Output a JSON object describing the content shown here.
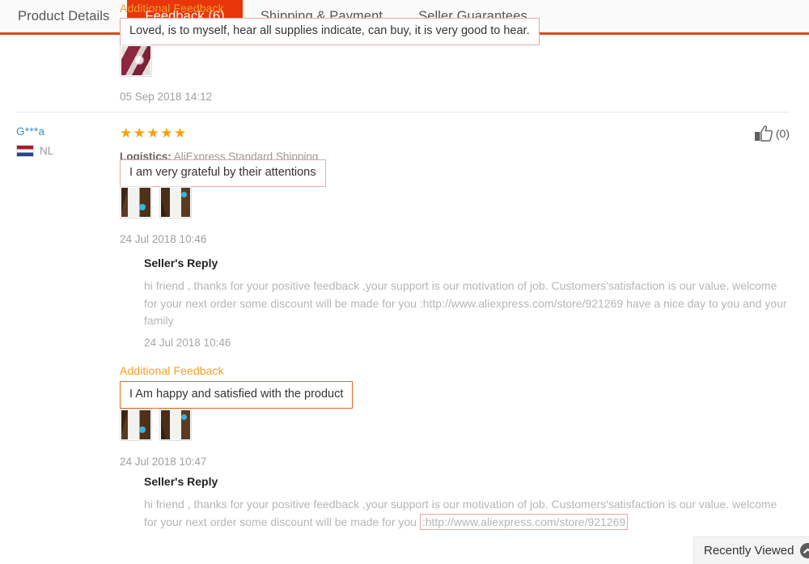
{
  "tabs": [
    {
      "label": "Product Details",
      "active": false
    },
    {
      "label": "Feedback (6)",
      "active": true
    },
    {
      "label": "Shipping & Payment",
      "active": false
    },
    {
      "label": "Seller Guarantees",
      "active": false
    }
  ],
  "colors": {
    "accent_red": "#e8360a",
    "tab_underline": "#d9481f",
    "star_orange": "#f7a200",
    "additional_feedback_orange": "#f0a02a",
    "username_blue": "#3a8ec9",
    "review_box_border": "#e8a6a6",
    "review_box_border_orange": "#dd6a2c"
  },
  "reviews": [
    {
      "additional_label": "Additional Feedback",
      "text": "Loved, is to myself, hear all supplies indicate, can buy, it is very good to hear.",
      "thumbnails": [
        "review-photo-maroon"
      ],
      "timestamp": "05 Sep 2018 14:12"
    },
    {
      "username": "G***a",
      "country_flag": "flag-netherlands",
      "country": "NL",
      "stars": 5,
      "stars_glyphs": "★★★★★",
      "logistics_label": "Logistics:",
      "logistics_value": "AliExpress Standard Shipping",
      "text": "I am very grateful by their attentions",
      "thumbnails": [
        "review-photo-wood-a",
        "review-photo-wood-b"
      ],
      "timestamp": "24 Jul 2018 10:46",
      "like_icon": "thumbs-up-icon",
      "like_count": "(0)",
      "reply": {
        "title": "Seller's Reply",
        "body_line1": "hi friend , thanks for your positive feedback ,your support is our motivation of job. Customers'satisfaction is our value.",
        "body_line2_before": "welcome for your next order some discount will be made for you :",
        "body_url": "http://www.aliexpress.com/store/921269",
        "body_line2_after": " have a nice day to",
        "body_line3": "you and your family",
        "timestamp": "24 Jul 2018 10:46"
      }
    },
    {
      "additional_label": "Additional Feedback",
      "text": "I Am happy and satisfied with the product",
      "thumbnails": [
        "review-photo-wood-a",
        "review-photo-wood-b"
      ],
      "timestamp": "24 Jul 2018 10:47",
      "reply": {
        "title": "Seller's Reply",
        "body_line1": "hi friend , thanks for your positive feedback ,your support is our motivation of job. Customers'satisfaction is our value.",
        "body_line2_before": "welcome for your next order some discount will be made for you ",
        "body_url": ":http://www.aliexpress.com/store/921269"
      }
    }
  ],
  "recently_viewed": {
    "label": "Recently Viewed",
    "icon": "chevron-up-icon"
  }
}
